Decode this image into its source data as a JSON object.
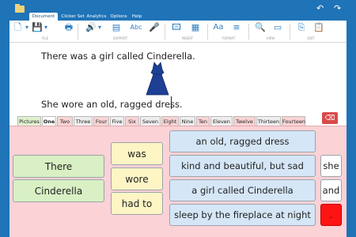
{
  "titlebar": {
    "tabs": [
      {
        "label": "Document",
        "active": true
      },
      {
        "label": "Clicker Set",
        "active": false
      },
      {
        "label": "Analytics",
        "active": false
      },
      {
        "label": "Options",
        "active": false
      },
      {
        "label": "Help",
        "active": false
      }
    ],
    "undo_icon": "undo-icon",
    "redo_icon": "redo-icon"
  },
  "ribbon": {
    "groups": [
      "FILE",
      "SUPPORT",
      "INSERT",
      "FORMAT",
      "VIEW",
      "EDIT"
    ],
    "format_label": "Aa"
  },
  "document": {
    "lines": [
      "There was a girl called Cinderella.",
      "She wore an old, ragged dress."
    ],
    "image": "blue-dress-picture"
  },
  "set_tabs": [
    {
      "label": "Pictures",
      "color": "green"
    },
    {
      "label": "One",
      "color": "active"
    },
    {
      "label": "Two",
      "color": "pink"
    },
    {
      "label": "Three",
      "color": "grey"
    },
    {
      "label": "Four",
      "color": "pink"
    },
    {
      "label": "Five",
      "color": "grey"
    },
    {
      "label": "Six",
      "color": "pink"
    },
    {
      "label": "Seven",
      "color": "grey"
    },
    {
      "label": "Eight",
      "color": "pink"
    },
    {
      "label": "Nine",
      "color": "grey"
    },
    {
      "label": "Ten",
      "color": "pink"
    },
    {
      "label": "Eleven",
      "color": "grey"
    },
    {
      "label": "Twelve",
      "color": "pink"
    },
    {
      "label": "Thirteen",
      "color": "grey"
    },
    {
      "label": "Fourteen",
      "color": "pink"
    }
  ],
  "grid": {
    "subjects": [
      "There",
      "Cinderella"
    ],
    "verbs": [
      "was",
      "wore",
      "had to"
    ],
    "phrases": [
      "an old, ragged dress",
      "kind and beautiful, but sad",
      "a girl called Cinderella",
      "sleep by the fireplace at night"
    ],
    "connectives": [
      "she",
      "and",
      "."
    ]
  },
  "colors": {
    "titlebar": "#1f73b7",
    "grid_background": "#fbd2d6",
    "green_cell": "#d8f0c4",
    "yellow_cell": "#fdf5c4",
    "blue_cell": "#d5e6f7",
    "red_cell": "#ff1414"
  }
}
